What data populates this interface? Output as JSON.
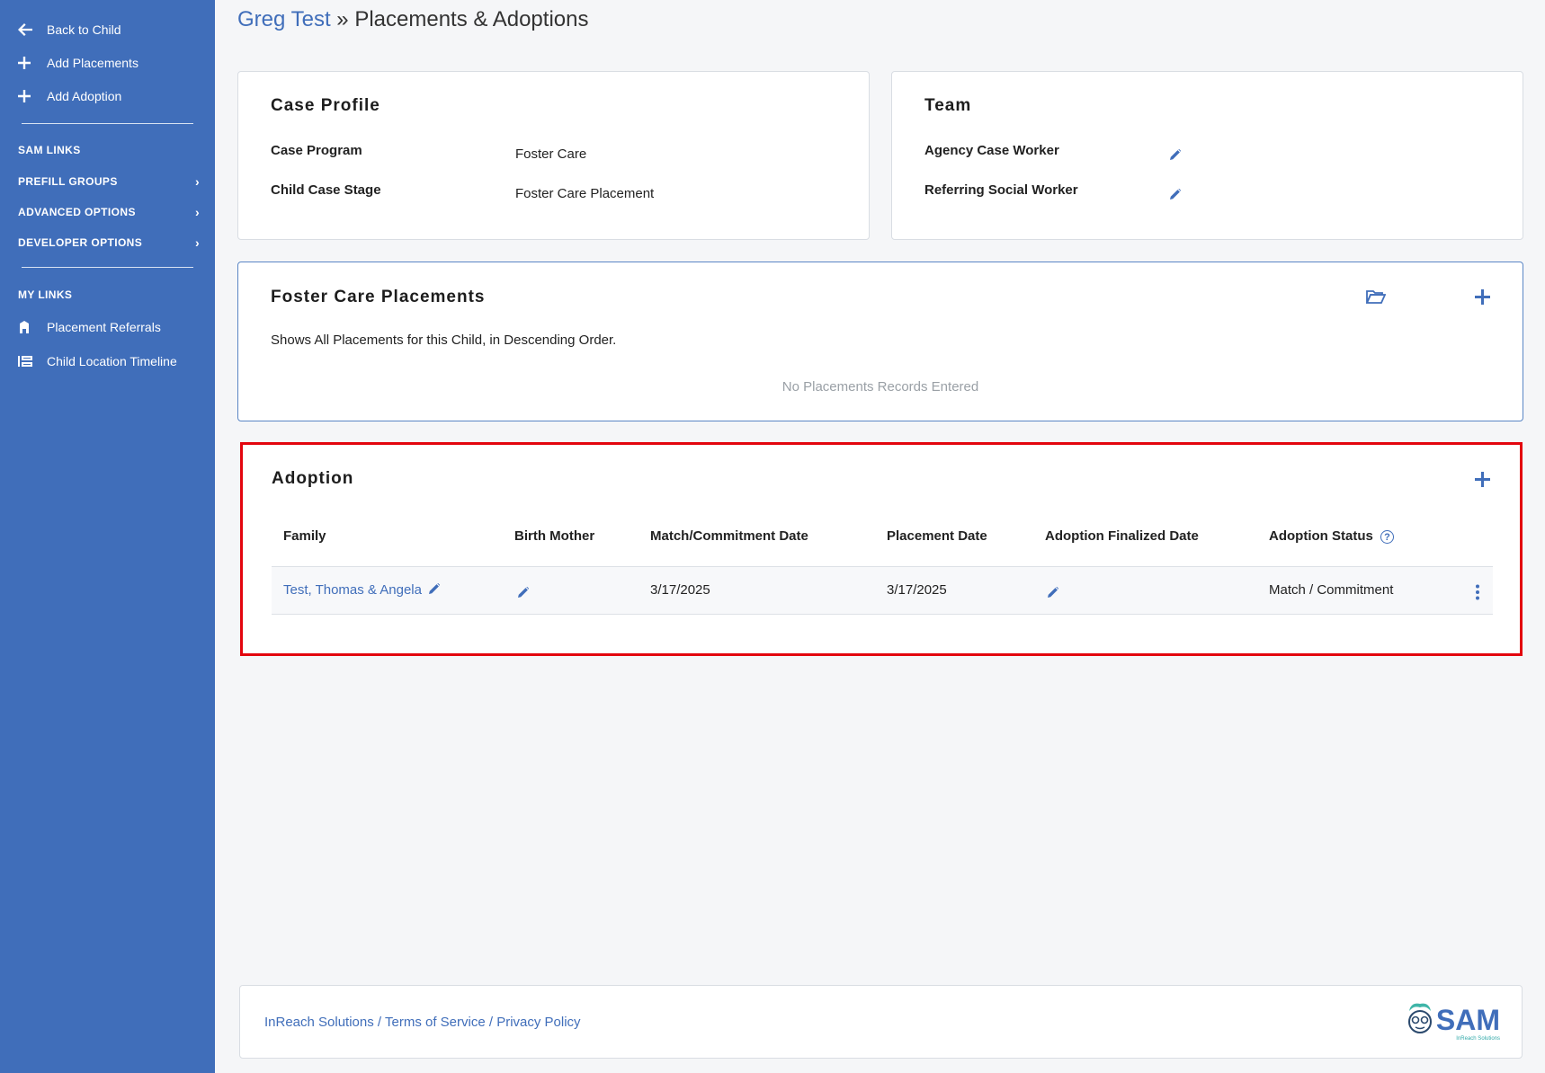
{
  "sidebar": {
    "top_links": [
      {
        "label": "Back to Child",
        "icon": "arrow-left-icon"
      },
      {
        "label": "Add Placements",
        "icon": "plus-icon"
      },
      {
        "label": "Add Adoption",
        "icon": "plus-icon"
      }
    ],
    "sections": [
      {
        "label": "SAM LINKS"
      },
      {
        "label": "PREFILL GROUPS",
        "chevron": "›"
      },
      {
        "label": "ADVANCED OPTIONS",
        "chevron": "›"
      },
      {
        "label": "DEVELOPER OPTIONS",
        "chevron": "›"
      }
    ],
    "my_links_header": "MY LINKS",
    "my_links": [
      {
        "label": "Placement Referrals",
        "icon": "building-icon"
      },
      {
        "label": "Child Location Timeline",
        "icon": "timeline-icon"
      }
    ]
  },
  "header": {
    "crumb": "Greg Test",
    "separator": "»",
    "title": "Placements & Adoptions"
  },
  "case_profile": {
    "title": "Case Profile",
    "fields": [
      {
        "label": "Case Program",
        "value": "Foster Care"
      },
      {
        "label": "Child Case Stage",
        "value": "Foster Care Placement"
      }
    ]
  },
  "team": {
    "title": "Team",
    "fields": [
      {
        "label": "Agency Case Worker"
      },
      {
        "label": "Referring Social Worker"
      }
    ]
  },
  "foster_care": {
    "title": "Foster Care Placements",
    "description": "Shows All Placements for this Child, in Descending Order.",
    "empty_text": "No Placements Records Entered"
  },
  "adoption": {
    "title": "Adoption",
    "columns": [
      "Family",
      "Birth Mother",
      "Match/Commitment Date",
      "Placement Date",
      "Adoption Finalized Date",
      "Adoption Status"
    ],
    "help_glyph": "?",
    "rows": [
      {
        "family": "Test, Thomas & Angela",
        "birth_mother": "",
        "match_date": "3/17/2025",
        "placement_date": "3/17/2025",
        "finalized_date": "",
        "status": "Match / Commitment"
      }
    ]
  },
  "footer": {
    "links": [
      "InReach Solutions",
      "Terms of Service",
      "Privacy Policy"
    ],
    "separator": " / ",
    "logo_text": "SAM",
    "logo_sub": "InReach Solutions"
  },
  "colors": {
    "sidebar_bg": "#406eba",
    "accent": "#406eba",
    "highlight_border": "#e3050e"
  }
}
